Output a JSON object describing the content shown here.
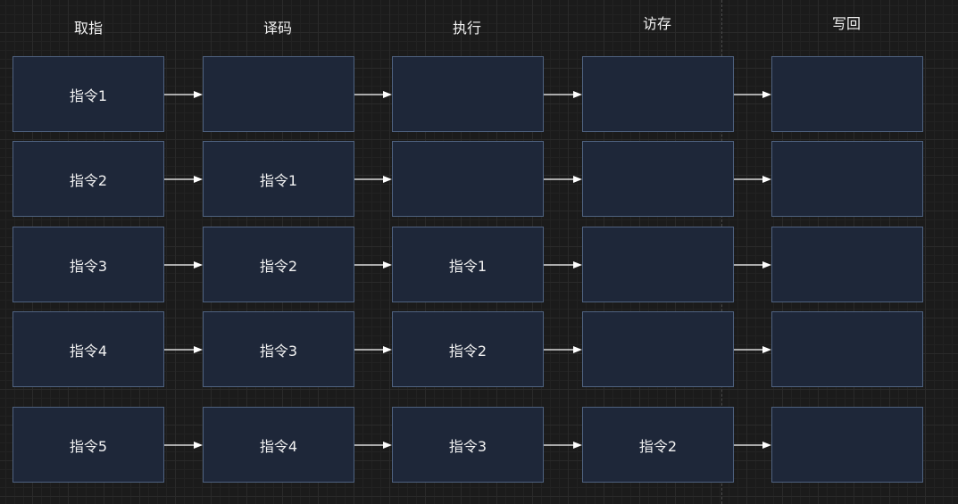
{
  "columns": [
    "取指",
    "译码",
    "执行",
    "访存",
    "写回"
  ],
  "rows": [
    [
      "指令1",
      "",
      "",
      "",
      ""
    ],
    [
      "指令2",
      "指令1",
      "",
      "",
      ""
    ],
    [
      "指令3",
      "指令2",
      "指令1",
      "",
      ""
    ],
    [
      "指令4",
      "指令3",
      "指令2",
      "",
      ""
    ],
    [
      "指令5",
      "指令4",
      "指令3",
      "指令2",
      ""
    ]
  ]
}
